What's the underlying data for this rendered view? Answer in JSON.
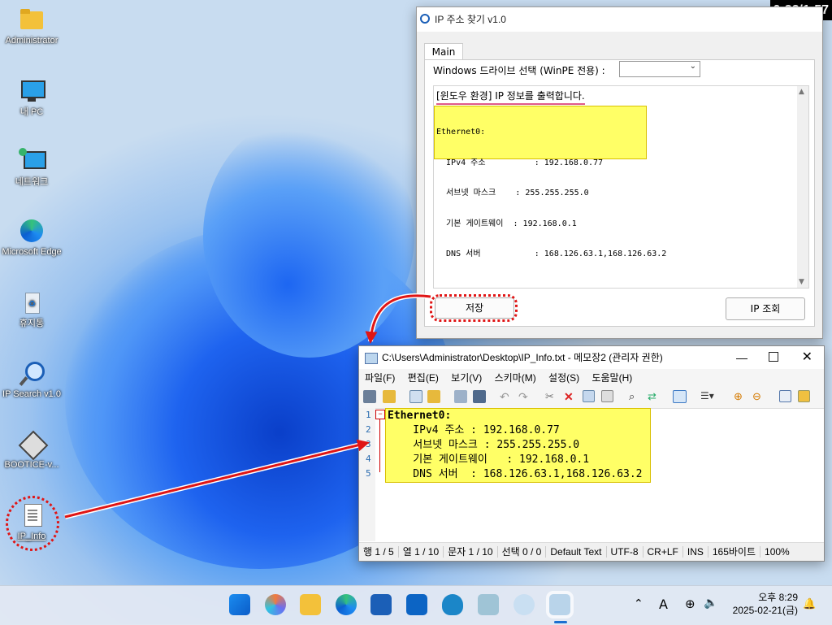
{
  "timer": "0:32/1:57",
  "desktop": {
    "icons": [
      {
        "label": "Administrator",
        "icon": "folder-icon"
      },
      {
        "label": "내 PC",
        "icon": "computer-icon"
      },
      {
        "label": "네트워크",
        "icon": "network-icon"
      },
      {
        "label": "Microsoft Edge",
        "icon": "edge-icon"
      },
      {
        "label": "휴지통",
        "icon": "recycle-bin-icon"
      },
      {
        "label": "IP Search v1.0",
        "icon": "ip-search-icon"
      },
      {
        "label": "BOOTICE-v...",
        "icon": "bootice-icon"
      },
      {
        "label": "IP_Info",
        "icon": "text-file-icon"
      }
    ]
  },
  "ip_window": {
    "title": "IP 주소 찾기 v1.0",
    "tab": "Main",
    "drive_label": "Windows 드라이브 선택 (WinPE 전용) :",
    "drive_value": "",
    "info_line": "[윈도우 환경] IP 정보를 출력합니다.",
    "output_lines": [
      "Ethernet0:",
      "  IPv4 주소          : 192.168.0.77",
      "  서브넷 마스크    : 255.255.255.0",
      "  기본 게이트웨이  : 192.168.0.1",
      "  DNS 서버           : 168.126.63.1,168.126.63.2"
    ],
    "save_button": "저장",
    "query_button": "IP 조회"
  },
  "notepad": {
    "title": "C:\\Users\\Administrator\\Desktop\\IP_Info.txt - 메모장2 (관리자 권한)",
    "menu": [
      "파일(F)",
      "편집(E)",
      "보기(V)",
      "스키마(M)",
      "설정(S)",
      "도움말(H)"
    ],
    "lines": [
      {
        "num": "1",
        "text": "Ethernet0:"
      },
      {
        "num": "2",
        "text": "    IPv4 주소 : 192.168.0.77"
      },
      {
        "num": "3",
        "text": "    서브넷 마스크 : 255.255.255.0"
      },
      {
        "num": "4",
        "text": "    기본 게이트웨이   : 192.168.0.1"
      },
      {
        "num": "5",
        "text": "    DNS 서버  : 168.126.63.1,168.126.63.2"
      }
    ],
    "status": [
      "행 1 / 5",
      "열 1 / 10",
      "문자 1 / 10",
      "선택 0 / 0",
      "Default Text",
      "UTF-8",
      "CR+LF",
      "INS",
      "165바이트",
      "100%"
    ]
  },
  "taskbar": {
    "time": "오후 8:29",
    "date": "2025-02-21(금)",
    "ime": "A"
  },
  "colors": {
    "highlight": "#ffff66",
    "accent": "#e01515"
  }
}
